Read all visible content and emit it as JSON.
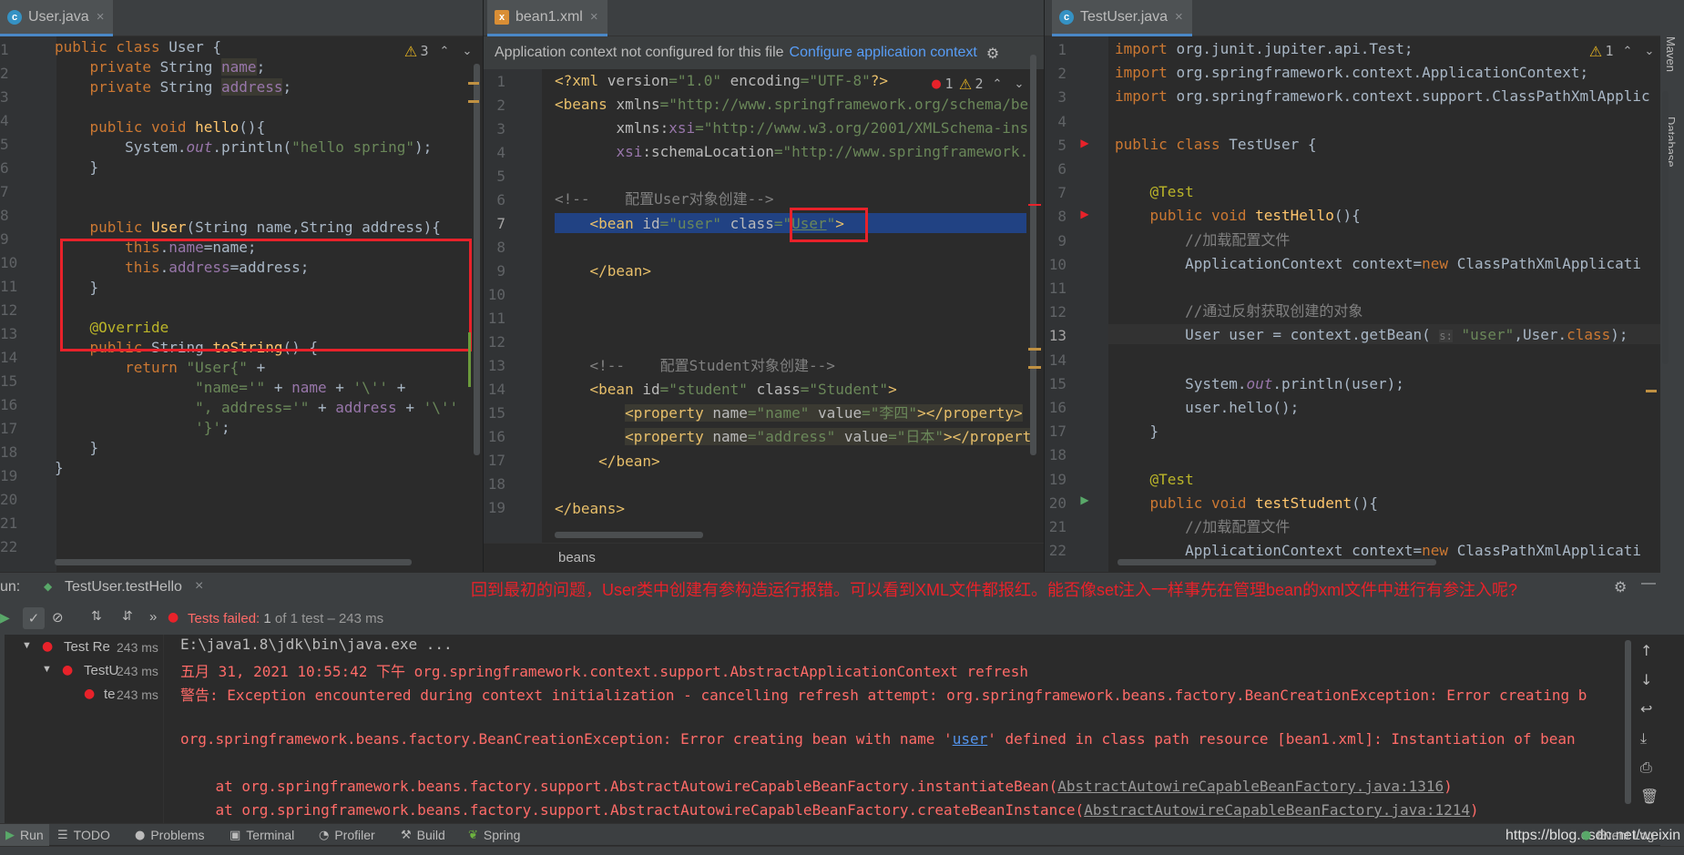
{
  "user_pane": {
    "tab": "User.java",
    "warnings": "3",
    "lines": [
      "1",
      "2",
      "3",
      "4",
      "5",
      "6",
      "7",
      "8",
      "9",
      "10",
      "11",
      "12",
      "13",
      "14",
      "15",
      "16",
      "17",
      "18",
      "19",
      "20",
      "21",
      "22"
    ]
  },
  "xml_pane": {
    "tab": "bean1.xml",
    "banner_text": "Application context not configured for this file",
    "banner_link": "Configure application context",
    "errors": "1",
    "warnings": "2",
    "breadcrumb": "beans",
    "lines": [
      "1",
      "2",
      "3",
      "4",
      "5",
      "6",
      "7",
      "8",
      "9",
      "10",
      "11",
      "12",
      "13",
      "14",
      "15",
      "16",
      "17",
      "18",
      "19"
    ]
  },
  "test_pane": {
    "tab": "TestUser.java",
    "warnings": "1",
    "param_hint": "s:",
    "lines": [
      "1",
      "2",
      "3",
      "4",
      "5",
      "6",
      "7",
      "8",
      "9",
      "10",
      "11",
      "12",
      "13",
      "14",
      "15",
      "16",
      "17",
      "18",
      "19",
      "20",
      "21",
      "22"
    ]
  },
  "run_panel": {
    "label": "un:",
    "config_tab": "TestUser.testHello",
    "status_prefix": "Tests failed:",
    "status_count": "1",
    "status_suffix": "of 1 test – 243 ms",
    "tree": [
      {
        "label": "Test Re",
        "time": "243 ms"
      },
      {
        "label": "TestU",
        "time": "243 ms"
      },
      {
        "label": "te",
        "time": "243 ms"
      }
    ],
    "annotation_note": "回到最初的问题，User类中创建有参构造运行报错。可以看到XML文件都报红。能否像set注入一样事先在管理bean的xml文件中进行有参注入呢?",
    "console": {
      "l1": "E:\\java1.8\\jdk\\bin\\java.exe ...",
      "l2": "五月 31, 2021 10:55:42 下午 org.springframework.context.support.AbstractApplicationContext refresh",
      "l3": "警告: Exception encountered during context initialization - cancelling refresh attempt: org.springframework.beans.factory.BeanCreationException: Error creating b",
      "l4a": "org.springframework.beans.factory.BeanCreationException: Error creating bean with name '",
      "l4b": "user",
      "l4c": "' defined in class path resource [bean1.xml]: Instantiation of bean ",
      "l5a": "    at org.springframework.beans.factory.support.AbstractAutowireCapableBeanFactory.instantiateBean(",
      "l5b": "AbstractAutowireCapableBeanFactory.java:1316",
      "l5c": ")",
      "l6a": "    at org.springframework.beans.factory.support.AbstractAutowireCapableBeanFactory.createBeanInstance(",
      "l6b": "AbstractAutowireCapableBeanFactory.java:1214",
      "l6c": ")"
    }
  },
  "bottom_bar": {
    "items": [
      "Run",
      "TODO",
      "Problems",
      "Terminal",
      "Profiler",
      "Build",
      "Spring"
    ],
    "watermark": "https://blog.csdn.net/weixin",
    "event_log": "Event Log"
  },
  "side_tools": {
    "maven": "Maven",
    "database": "Database"
  }
}
